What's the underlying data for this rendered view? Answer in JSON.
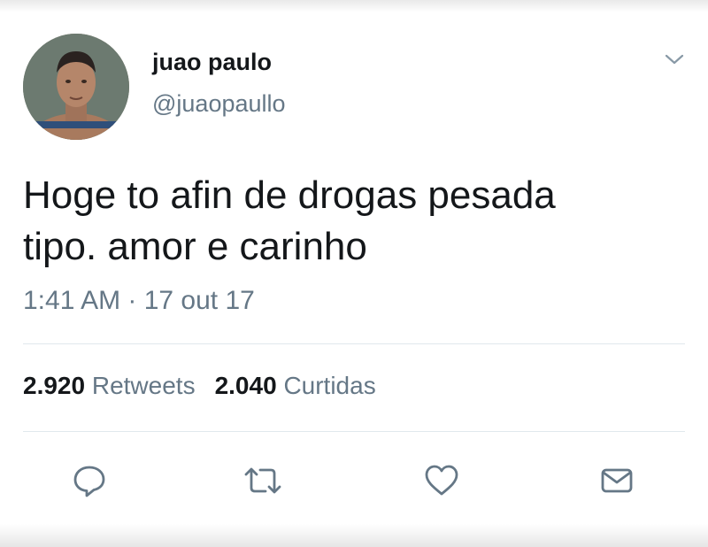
{
  "tweet": {
    "author": {
      "display_name": "juao paulo",
      "handle": "@juaopaullo",
      "avatar_icon": "user-photo-avatar"
    },
    "text_lines": [
      "Hoge to afin de drogas pesada",
      "tipo. amor e carinho"
    ],
    "timestamp": "1:41 AM · 17 out 17",
    "stats": {
      "retweets_count": "2.920",
      "retweets_label": "Retweets",
      "likes_count": "2.040",
      "likes_label": "Curtidas"
    },
    "actions": [
      {
        "name": "reply",
        "icon": "speech-bubble-icon"
      },
      {
        "name": "retweet",
        "icon": "retweet-arrows-icon"
      },
      {
        "name": "like",
        "icon": "heart-icon"
      },
      {
        "name": "direct-message",
        "icon": "envelope-icon"
      }
    ],
    "menu_icon": "chevron-down-icon"
  },
  "colors": {
    "primary_text": "#14171a",
    "secondary_text": "#657786",
    "divider": "#e1e8ed",
    "icon": "#657786"
  }
}
